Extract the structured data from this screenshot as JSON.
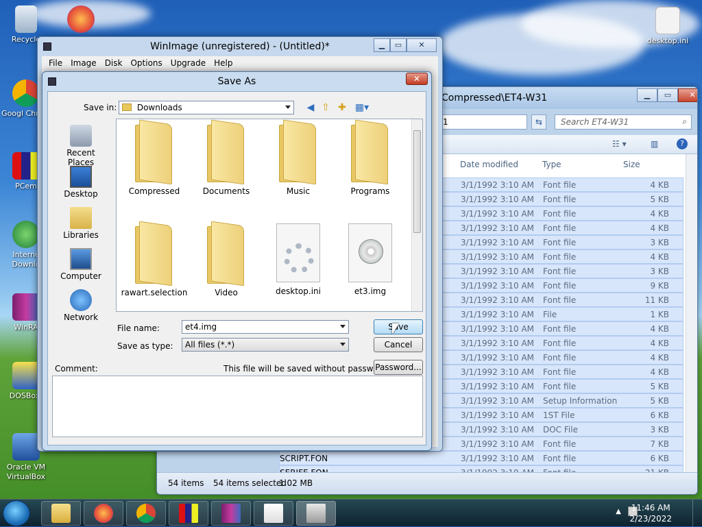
{
  "desktop": {
    "icons": [
      {
        "label": "Recycle"
      },
      {
        "label": "Googl Chrom"
      },
      {
        "label": "PCem"
      },
      {
        "label": "Interne Downlo"
      },
      {
        "label": "WinRA"
      },
      {
        "label": "DOSBox-"
      },
      {
        "label": "Oracle VM VirtualBox"
      },
      {
        "label": "desktop.ini"
      }
    ]
  },
  "explorer": {
    "title": "Compressed\\ET4-W31",
    "address": "1",
    "search_placeholder": "Search ET4-W31",
    "columns": {
      "date": "Date modified",
      "type": "Type",
      "size": "Size"
    },
    "rows": [
      {
        "name": "",
        "date": "3/1/1992 3:10 AM",
        "type": "Font file",
        "size": "4 KB"
      },
      {
        "name": "",
        "date": "3/1/1992 3:10 AM",
        "type": "Font file",
        "size": "5 KB"
      },
      {
        "name": "",
        "date": "3/1/1992 3:10 AM",
        "type": "Font file",
        "size": "4 KB"
      },
      {
        "name": "",
        "date": "3/1/1992 3:10 AM",
        "type": "Font file",
        "size": "4 KB"
      },
      {
        "name": "",
        "date": "3/1/1992 3:10 AM",
        "type": "Font file",
        "size": "3 KB"
      },
      {
        "name": "",
        "date": "3/1/1992 3:10 AM",
        "type": "Font file",
        "size": "4 KB"
      },
      {
        "name": "",
        "date": "3/1/1992 3:10 AM",
        "type": "Font file",
        "size": "3 KB"
      },
      {
        "name": "",
        "date": "3/1/1992 3:10 AM",
        "type": "Font file",
        "size": "9 KB"
      },
      {
        "name": "",
        "date": "3/1/1992 3:10 AM",
        "type": "Font file",
        "size": "11 KB"
      },
      {
        "name": "",
        "date": "3/1/1992 3:10 AM",
        "type": "File",
        "size": "1 KB"
      },
      {
        "name": "",
        "date": "3/1/1992 3:10 AM",
        "type": "Font file",
        "size": "4 KB"
      },
      {
        "name": "",
        "date": "3/1/1992 3:10 AM",
        "type": "Font file",
        "size": "4 KB"
      },
      {
        "name": "",
        "date": "3/1/1992 3:10 AM",
        "type": "Font file",
        "size": "4 KB"
      },
      {
        "name": "",
        "date": "3/1/1992 3:10 AM",
        "type": "Font file",
        "size": "4 KB"
      },
      {
        "name": "",
        "date": "3/1/1992 3:10 AM",
        "type": "Font file",
        "size": "5 KB"
      },
      {
        "name": "",
        "date": "3/1/1992 3:10 AM",
        "type": "Setup Information",
        "size": "5 KB"
      },
      {
        "name": "",
        "date": "3/1/1992 3:10 AM",
        "type": "1ST File",
        "size": "6 KB"
      },
      {
        "name": "",
        "date": "3/1/1992 3:10 AM",
        "type": "DOC File",
        "size": "3 KB"
      },
      {
        "name": "",
        "date": "3/1/1992 3:10 AM",
        "type": "Font file",
        "size": "7 KB"
      },
      {
        "name": "SCRIPT.FON",
        "date": "3/1/1992 3:10 AM",
        "type": "Font file",
        "size": "6 KB"
      },
      {
        "name": "SERIFE.FON",
        "date": "3/1/1992 3:10 AM",
        "type": "Font file",
        "size": "21 KB"
      }
    ],
    "status": {
      "count": "54 items",
      "selected": "54 items selected",
      "size": "1.02 MB"
    }
  },
  "winimage": {
    "title": "WinImage (unregistered) - (Untitled)*",
    "menu": [
      "File",
      "Image",
      "Disk",
      "Options",
      "Upgrade",
      "Help"
    ]
  },
  "saveas": {
    "title": "Save As",
    "close": "✕",
    "save_in_label": "Save in:",
    "save_in_value": "Downloads",
    "places": [
      "Recent Places",
      "Desktop",
      "Libraries",
      "Computer",
      "Network"
    ],
    "files": [
      {
        "name": "Compressed",
        "kind": "folder"
      },
      {
        "name": "Documents",
        "kind": "folder"
      },
      {
        "name": "Music",
        "kind": "folder"
      },
      {
        "name": "Programs",
        "kind": "folder"
      },
      {
        "name": "rawart.selection",
        "kind": "folder"
      },
      {
        "name": "Video",
        "kind": "folder"
      },
      {
        "name": "desktop.ini",
        "kind": "settings"
      },
      {
        "name": "et3.img",
        "kind": "disc"
      }
    ],
    "filename_label": "File name:",
    "filename_value": "et4.img",
    "type_label": "Save as type:",
    "type_value": "All files (*.*)",
    "save_btn": "Save",
    "cancel_btn": "Cancel",
    "comment_label": "Comment:",
    "password_note": "This file will be saved without password",
    "password_btn": "Password..."
  },
  "taskbar": {
    "time": "11:46 AM",
    "date": "2/23/2022"
  }
}
